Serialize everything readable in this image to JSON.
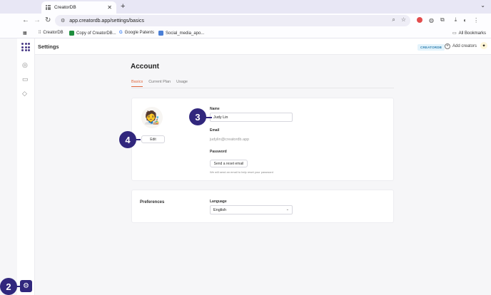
{
  "browser": {
    "tab_title": "CreatorDB",
    "tab_close": "✕",
    "new_tab": "+",
    "url": "app.creatordb.app/settings/basics",
    "bookmarks": [
      {
        "label": "CreatorDB",
        "icon": "grid-icon",
        "color": "#555555"
      },
      {
        "label": "Copy of CreatorDB...",
        "icon": "sheets-icon",
        "color": "#1e8e3e"
      },
      {
        "label": "Google Patents",
        "icon": "google-icon",
        "color": "#4285f4"
      },
      {
        "label": "Social_media_apo...",
        "icon": "docs-icon",
        "color": "#4a7fd6"
      }
    ],
    "all_bookmarks": "All Bookmarks"
  },
  "app": {
    "header_title": "Settings",
    "brand_badge": "CREATORDB",
    "add_creators": "Add creators",
    "page_title": "Account",
    "tabs": [
      {
        "label": "Basics",
        "active": true
      },
      {
        "label": "Current Plan",
        "active": false
      },
      {
        "label": "Usage",
        "active": false
      }
    ],
    "profile": {
      "edit_label": "Edit",
      "name_label": "Name",
      "name_value": "Judy Lin",
      "email_label": "Email",
      "email_value": "judylin@creatordb.app",
      "password_label": "Password",
      "reset_button": "Send a reset email",
      "reset_hint": "We will send an email to help reset your password"
    },
    "preferences": {
      "title": "Preferences",
      "language_label": "Language",
      "language_value": "English"
    }
  },
  "callouts": {
    "step2": "2",
    "step3": "3",
    "step4": "4"
  },
  "colors": {
    "accent": "#e0683e",
    "callout": "#31277d"
  }
}
